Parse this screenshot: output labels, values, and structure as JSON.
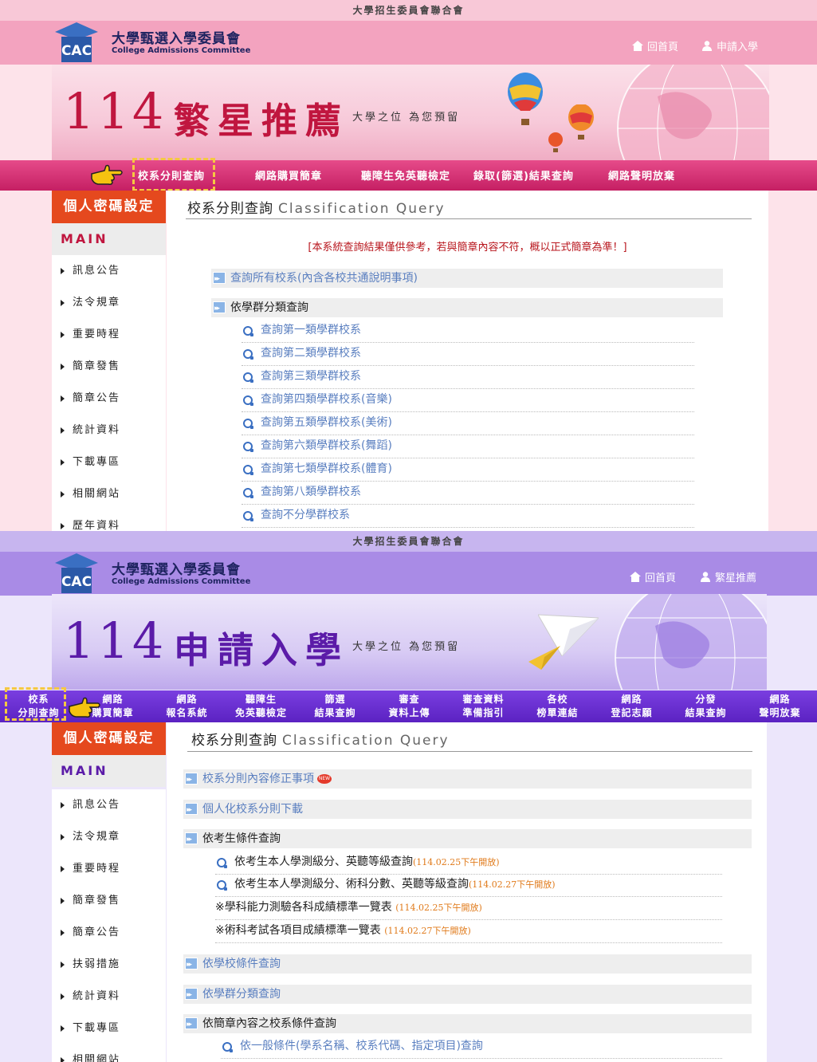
{
  "panel_a": {
    "top_strip": "大學招生委員會聯合會",
    "org_cn": "大學甄選入學委員會",
    "org_en": "College Admissions Committee",
    "toplinks": [
      "回首頁",
      "申請入學"
    ],
    "banner": {
      "number": "114",
      "title": "繁星推薦",
      "slogan": "大學之位 為您預留"
    },
    "nav": [
      "校系分則查詢",
      "網路購買簡章",
      "聽障生免英聽檢定",
      "錄取(篩選)結果查詢",
      "網路聲明放棄"
    ],
    "pw_button": "個人密碼設定",
    "main_menu": "MAIN MENU",
    "menu": [
      "訊息公告",
      "法令規章",
      "重要時程",
      "簡章發售",
      "簡章公告",
      "統計資料",
      "下載專區",
      "相關網站",
      "歷年資料"
    ],
    "page_title": "校系分則查詢",
    "page_title_en": "Classification Query",
    "notice": "[本系統查詢結果僅供參考，若與簡章內容不符，概以正式簡章為準！]",
    "sections": [
      "查詢所有校系(內含各校共通說明事項)",
      "依學群分類查詢"
    ],
    "sub_items": [
      "查詢第一類學群校系",
      "查詢第二類學群校系",
      "查詢第三類學群校系",
      "查詢第四類學群校系(音樂)",
      "查詢第五類學群校系(美術)",
      "查詢第六類學群校系(舞蹈)",
      "查詢第七類學群校系(體育)",
      "查詢第八類學群校系",
      "查詢不分學群校系"
    ]
  },
  "panel_b": {
    "top_strip": "大學招生委員會聯合會",
    "org_cn": "大學甄選入學委員會",
    "org_en": "College Admissions Committee",
    "toplinks": [
      "回首頁",
      "繁星推薦"
    ],
    "banner": {
      "number": "114",
      "title": "申請入學",
      "slogan": "大學之位 為您預留"
    },
    "nav": [
      [
        "校系",
        "分則查詢"
      ],
      [
        "網路",
        "購買簡章"
      ],
      [
        "網路",
        "報名系統"
      ],
      [
        "聽障生",
        "免英聽檢定"
      ],
      [
        "篩選",
        "結果查詢"
      ],
      [
        "審查",
        "資料上傳"
      ],
      [
        "審查資料",
        "準備指引"
      ],
      [
        "各校",
        "榜單連結"
      ],
      [
        "網路",
        "登記志願"
      ],
      [
        "分發",
        "結果查詢"
      ],
      [
        "網路",
        "聲明放棄"
      ]
    ],
    "pw_button": "個人密碼設定",
    "main_menu": "MAIN MENU",
    "menu": [
      "訊息公告",
      "法令規章",
      "重要時程",
      "簡章發售",
      "簡章公告",
      "扶弱措施",
      "統計資料",
      "下載專區",
      "相關網站"
    ],
    "page_title": "校系分則查詢",
    "page_title_en": "Classification Query",
    "new_badge": "NEW",
    "sections": [
      "校系分則內容修正事項",
      "個人化校系分則下載",
      "依考生條件查詢",
      "依學校條件查詢",
      "依學群分類查詢",
      "依簡章內容之校系條件查詢"
    ],
    "cond_items": [
      {
        "text": "依考生本人學測級分、英聽等級查詢",
        "date": "(114.02.25下午開放)"
      },
      {
        "text": "依考生本人學測級分、術科分數、英聽等級查詢",
        "date": "(114.02.27下午開放)"
      }
    ],
    "note_items": [
      {
        "text": "※學科能力測驗各科成績標準一覽表 ",
        "date": "(114.02.25下午開放)"
      },
      {
        "text": "※術科考試各項目成績標準一覽表 ",
        "date": "(114.02.27下午開放)"
      }
    ],
    "last_item": "依一般條件(學系名稱、校系代碼、指定項目)查詢"
  },
  "colors": {
    "pink_nav": "#c51f63",
    "purple_nav": "#5b22c2",
    "pw_button": "#e5491e",
    "highlight": "#f5c842",
    "link": "#5a7fc0",
    "notice": "#b8161d",
    "date": "#e07a1a"
  },
  "icons": [
    "cac-logo-icon",
    "home-icon",
    "user-icon",
    "pointing-hand-icon",
    "double-arrow-icon",
    "ring-bullet-icon",
    "new-badge-icon",
    "globe-icon",
    "hot-air-balloon-icon",
    "paper-plane-icon"
  ]
}
